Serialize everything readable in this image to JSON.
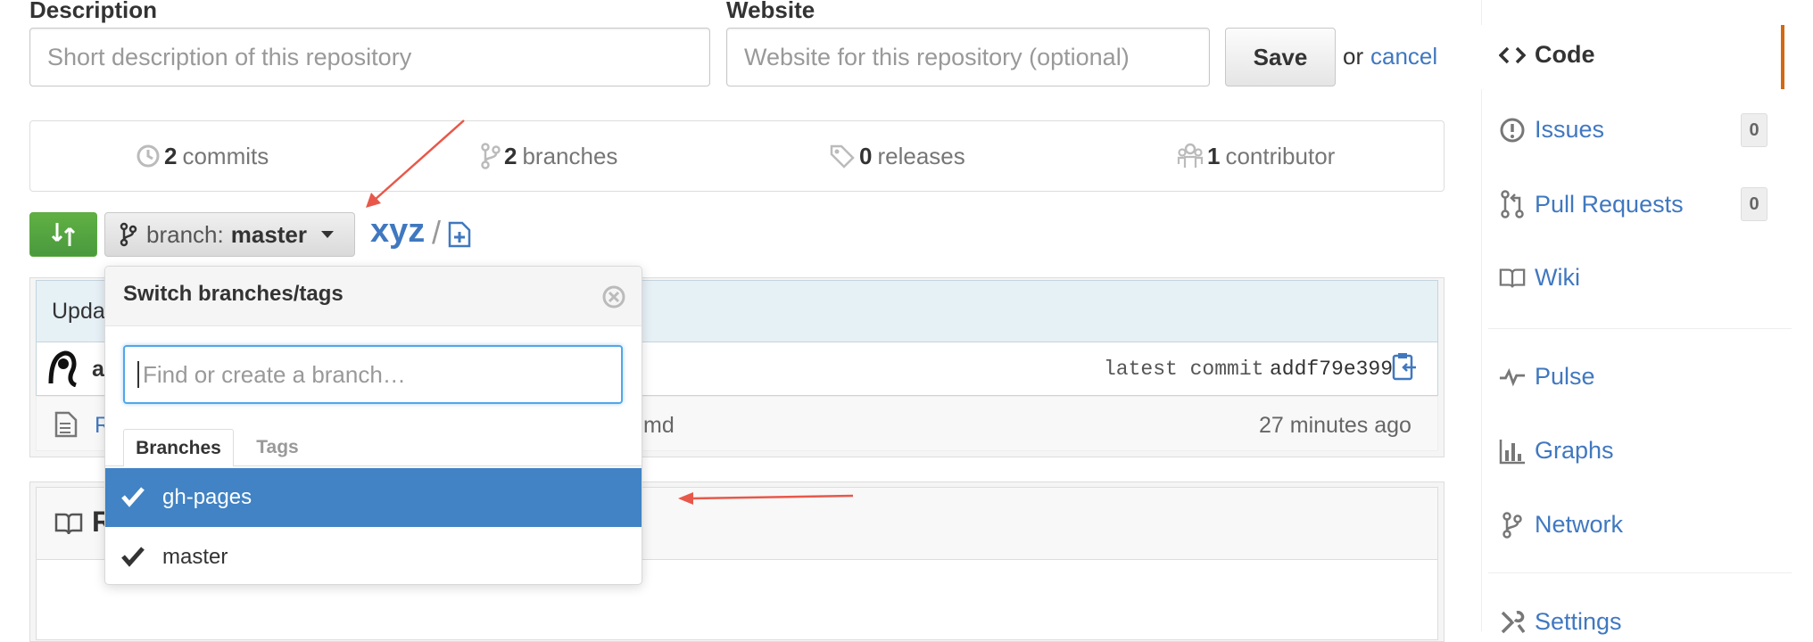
{
  "form": {
    "description_label": "Description",
    "description_placeholder": "Short description of this repository",
    "website_label": "Website",
    "website_placeholder": "Website for this repository (optional)",
    "save_label": "Save",
    "or_text": "or",
    "cancel_label": "cancel"
  },
  "stats": {
    "commits_count": "2",
    "commits_label": "commits",
    "branches_count": "2",
    "branches_label": "branches",
    "releases_count": "0",
    "releases_label": "releases",
    "contributors_count": "1",
    "contributors_label": "contributor"
  },
  "branch_bar": {
    "prefix": "branch:",
    "current_branch": "master",
    "repo_name": "xyz",
    "separator": "/"
  },
  "commit": {
    "message_partial": "Upda",
    "author_partial": "ad",
    "latest_label": "latest commit",
    "sha": "addf79e399"
  },
  "files": [
    {
      "name_partial": "R",
      "name_suffix": "md",
      "age": "27 minutes ago"
    }
  ],
  "readme": {
    "title_partial": "R"
  },
  "dropdown": {
    "title": "Switch branches/tags",
    "filter_placeholder": "Find or create a branch…",
    "tabs": [
      "Branches",
      "Tags"
    ],
    "items": [
      {
        "name": "gh-pages",
        "selected": true
      },
      {
        "name": "master",
        "selected": false
      }
    ]
  },
  "sidebar": {
    "items": [
      {
        "label": "Code",
        "icon": "code-icon",
        "active": true
      },
      {
        "label": "Issues",
        "icon": "issue-icon",
        "count": "0"
      },
      {
        "label": "Pull Requests",
        "icon": "pull-request-icon",
        "count": "0"
      },
      {
        "label": "Wiki",
        "icon": "book-icon"
      },
      {
        "label": "Pulse",
        "icon": "pulse-icon"
      },
      {
        "label": "Graphs",
        "icon": "graph-icon"
      },
      {
        "label": "Network",
        "icon": "network-icon"
      },
      {
        "label": "Settings",
        "icon": "tools-icon"
      }
    ]
  },
  "colors": {
    "link": "#4078c0",
    "selected_item": "#4183c4",
    "compare_green": "#55a532",
    "annotation_arrow": "#e8584a",
    "sidebar_active_border": "#d26911"
  }
}
